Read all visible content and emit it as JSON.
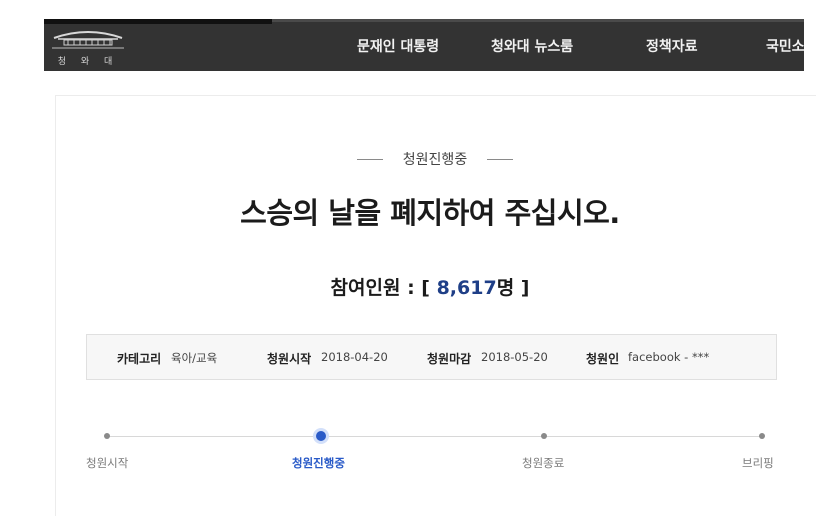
{
  "header": {
    "logo_text": "청 와 대",
    "logo_icon": "blue-house-roof-icon",
    "nav": [
      {
        "label": "문재인 대통령"
      },
      {
        "label": "청와대 뉴스룸"
      },
      {
        "label": "정책자료"
      },
      {
        "label": "국민소"
      }
    ]
  },
  "petition": {
    "status": "청원진행중",
    "title": "스승의 날을 폐지하여 주십시오.",
    "count_prefix": "참여인원 : [ ",
    "count_value": "8,617",
    "count_suffix": "명 ]",
    "meta": {
      "category_label": "카테고리",
      "category_value": "육아/교육",
      "start_label": "청원시작",
      "start_value": "2018-04-20",
      "end_label": "청원마감",
      "end_value": "2018-05-20",
      "author_label": "청원인",
      "author_value": "facebook - ***"
    }
  },
  "progress": {
    "active_color": "#2a5bc8",
    "steps": [
      {
        "label": "청원시작",
        "active": false
      },
      {
        "label": "청원진행중",
        "active": true
      },
      {
        "label": "청원종료",
        "active": false
      },
      {
        "label": "브리핑",
        "active": false
      }
    ]
  }
}
